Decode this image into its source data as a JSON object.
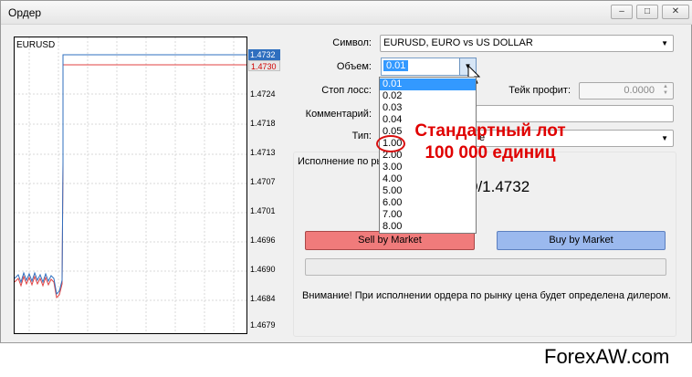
{
  "window": {
    "title": "Ордер",
    "buttons": [
      "–",
      "□",
      "✕"
    ]
  },
  "chart": {
    "symbol": "EURUSD",
    "ask_tag": "1.4732",
    "bid_tag": "1.4730",
    "y_labels": [
      "1.4724",
      "1.4718",
      "1.4713",
      "1.4707",
      "1.4701",
      "1.4696",
      "1.4690",
      "1.4684",
      "1.4679"
    ]
  },
  "form": {
    "symbol_label": "Символ:",
    "symbol_value": "EURUSD, EURO vs US DOLLAR",
    "volume_label": "Объем:",
    "volume_value": "0.01",
    "sl_label": "Стоп лосс:",
    "tp_label": "Тейк профит:",
    "tp_value": "0.0000",
    "comment_label": "Комментарий:",
    "type_label": "Тип:",
    "type_value_suffix": "e",
    "exec_label": "Исполнение по ры",
    "price_fragment": "0/1.4732"
  },
  "dropdown": {
    "options": [
      "0.01",
      "0.02",
      "0.03",
      "0.04",
      "0.05",
      "1.00",
      "2.00",
      "3.00",
      "4.00",
      "5.00",
      "6.00",
      "7.00",
      "8.00"
    ],
    "selected_index": 0
  },
  "annotation": {
    "line1": "Стандартный лот",
    "line2": "100 000 единиц"
  },
  "buttons": {
    "sell": "Sell by Market",
    "buy": "Buy by Market"
  },
  "warning": "Внимание! При исполнении ордера по рынку цена будет определена дилером.",
  "watermark": "ForexAW.com",
  "colors": {
    "ask_line": "#2f6fbf",
    "bid_line": "#e04040",
    "sell": "#f07b7b",
    "buy": "#9bb9ee",
    "annotation": "#e00000",
    "selection": "#3399ff"
  }
}
